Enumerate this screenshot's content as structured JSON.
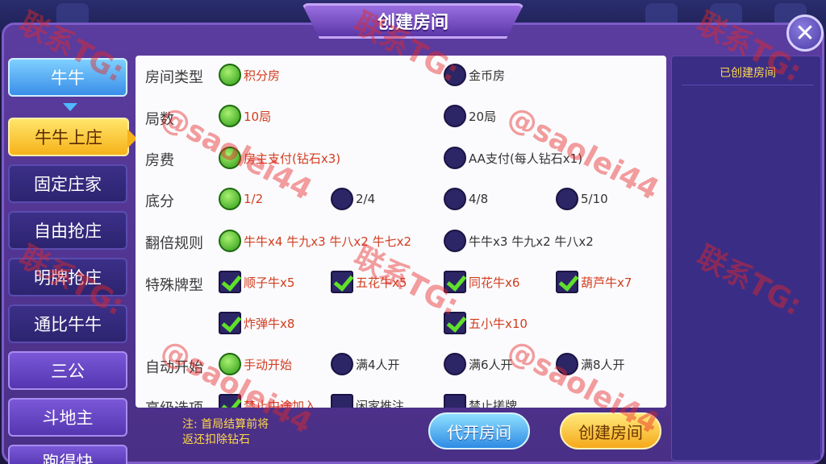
{
  "dialog": {
    "title": "创建房间",
    "close_symbol": "✕"
  },
  "sidebar": {
    "categories": [
      {
        "label": "牛牛",
        "active": true
      },
      {
        "label": "三公",
        "active": false
      },
      {
        "label": "斗地主",
        "active": false
      },
      {
        "label": "跑得快",
        "active": false
      }
    ],
    "sub_modes": [
      {
        "label": "牛牛上庄",
        "active": true
      },
      {
        "label": "固定庄家",
        "active": false
      },
      {
        "label": "自由抢庄",
        "active": false
      },
      {
        "label": "明牌抢庄",
        "active": false
      },
      {
        "label": "通比牛牛",
        "active": false
      }
    ]
  },
  "settings": {
    "room_type": {
      "label": "房间类型",
      "options": [
        {
          "text": "积分房",
          "selected": true
        },
        {
          "text": "金币房",
          "selected": false
        }
      ]
    },
    "rounds": {
      "label": "局数",
      "options": [
        {
          "text": "10局",
          "selected": true
        },
        {
          "text": "20局",
          "selected": false
        }
      ]
    },
    "fee": {
      "label": "房费",
      "options": [
        {
          "text": "房主支付(钻石x3)",
          "selected": true
        },
        {
          "text": "AA支付(每人钻石x1)",
          "selected": false
        }
      ]
    },
    "base_score": {
      "label": "底分",
      "options": [
        {
          "text": "1/2",
          "selected": true
        },
        {
          "text": "2/4",
          "selected": false
        },
        {
          "text": "4/8",
          "selected": false
        },
        {
          "text": "5/10",
          "selected": false
        }
      ]
    },
    "multiplier": {
      "label": "翻倍规则",
      "options": [
        {
          "text": "牛牛x4 牛九x3 牛八x2 牛七x2",
          "selected": true
        },
        {
          "text": "牛牛x3 牛九x2 牛八x2",
          "selected": false
        }
      ]
    },
    "special_hands": {
      "label": "特殊牌型",
      "options": [
        {
          "text": "顺子牛x5",
          "checked": true
        },
        {
          "text": "五花牛x5",
          "checked": true
        },
        {
          "text": "同花牛x6",
          "checked": true
        },
        {
          "text": "葫芦牛x7",
          "checked": true
        },
        {
          "text": "炸弹牛x8",
          "checked": true
        },
        {
          "text": "五小牛x10",
          "checked": true
        }
      ]
    },
    "auto_start": {
      "label": "自动开始",
      "options": [
        {
          "text": "手动开始",
          "selected": true
        },
        {
          "text": "满4人开",
          "selected": false
        },
        {
          "text": "满6人开",
          "selected": false
        },
        {
          "text": "满8人开",
          "selected": false
        }
      ]
    },
    "advanced": {
      "label": "高级选项",
      "options": [
        {
          "text": "禁止中途加入",
          "checked": true
        },
        {
          "text": "闲家推注",
          "checked": false
        },
        {
          "text": "禁止搓牌",
          "checked": false
        }
      ]
    }
  },
  "footer": {
    "note_line1": "注: 首局结算前将",
    "note_line2": "返还扣除钻石",
    "proxy_button": "代开房间",
    "create_button": "创建房间"
  },
  "right_panel": {
    "header": "已创建房间"
  },
  "watermark": {
    "line1": "联系TG:",
    "line2": "@saolei44"
  },
  "colors": {
    "selected_text": "#d23c1e",
    "accent_yellow": "#ffd94a",
    "dialog_purple": "#5b3c9f"
  }
}
